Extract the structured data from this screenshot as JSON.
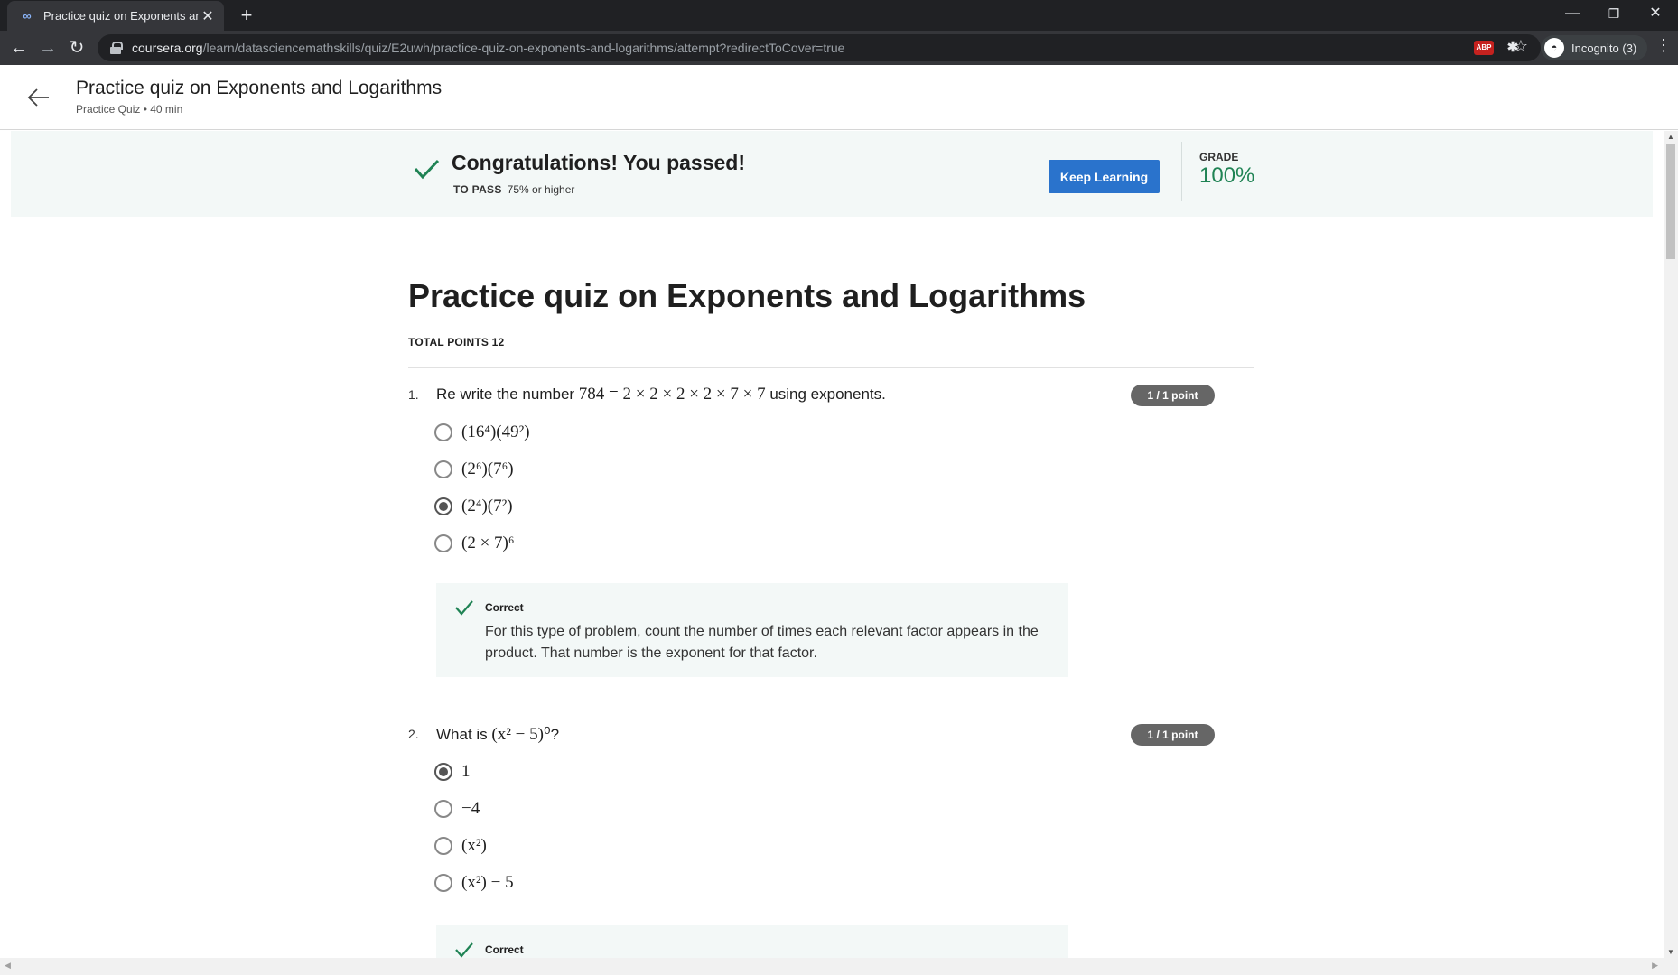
{
  "browser": {
    "tab_title": "Practice quiz on Exponents and L",
    "favicon": "coursera-icon",
    "url_host": "coursera.org",
    "url_path": "/learn/datasciencemathskills/quiz/E2uwh/practice-quiz-on-exponents-and-logarithms/attempt?redirectToCover=true",
    "profile_label": "Incognito (3)",
    "abp_label": "ABP"
  },
  "header": {
    "title": "Practice quiz on Exponents and Logarithms",
    "subtitle": "Practice Quiz • 40 min"
  },
  "banner": {
    "title": "Congratulations! You passed!",
    "to_pass_label": "TO PASS",
    "to_pass_value": "75% or higher",
    "button_label": "Keep Learning",
    "grade_label": "GRADE",
    "grade_value": "100%",
    "accent_color": "#1f8354",
    "button_color": "#2a73cc"
  },
  "quiz": {
    "title": "Practice quiz on Exponents and Logarithms",
    "total_points": "TOTAL POINTS 12",
    "questions": [
      {
        "number": "1.",
        "text_before": "Re write the number ",
        "math": "784 = 2 × 2 × 2 × 2 × 7 × 7",
        "text_after": " using exponents.",
        "points": "1 / 1 point",
        "options": [
          "(16⁴)(49²)",
          "(2⁶)(7⁶)",
          "(2⁴)(7²)",
          "(2 × 7)⁶"
        ],
        "selected_index": 2,
        "feedback_title": "Correct",
        "feedback_body": "For this type of problem, count the number of times each relevant factor appears in the product. That number is the exponent for that factor."
      },
      {
        "number": "2.",
        "text_before": "What is ",
        "math": "(x² − 5)⁰",
        "text_after": "?",
        "points": "1 / 1 point",
        "options": [
          "1",
          "−4",
          "(x²)",
          "(x²) − 5"
        ],
        "selected_index": 0,
        "feedback_title": "Correct"
      }
    ]
  }
}
